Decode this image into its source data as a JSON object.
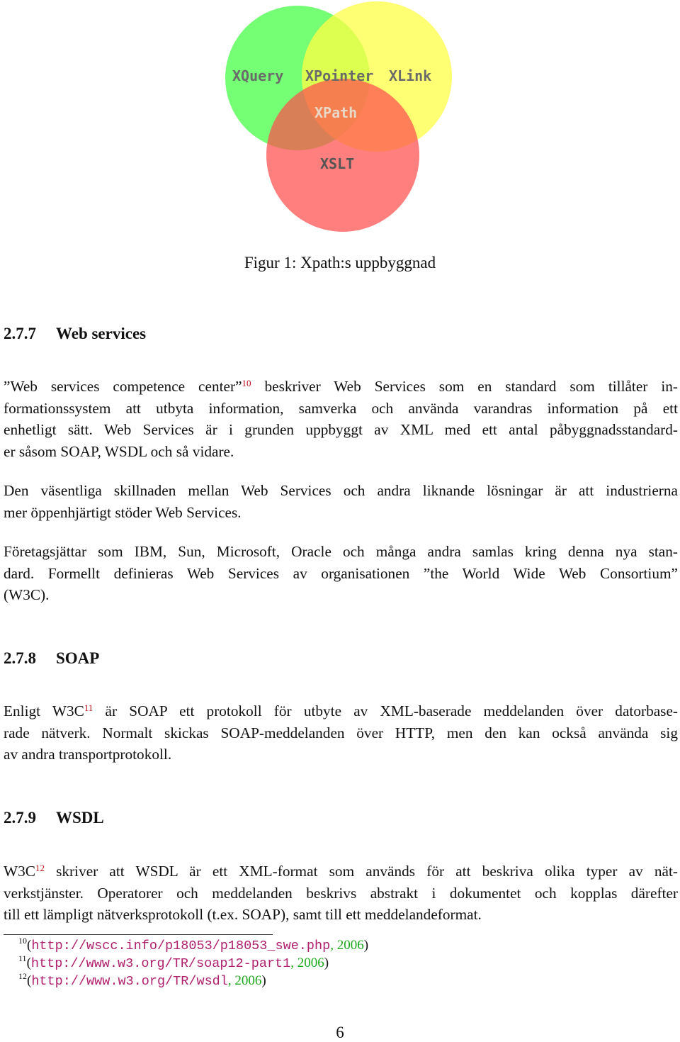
{
  "figure": {
    "circles": [
      {
        "name": "XQuery",
        "color": "#66ff66"
      },
      {
        "name": "XLink",
        "color": "#ffff66"
      },
      {
        "name": "XSLT",
        "color": "#ff6666"
      }
    ],
    "labels": {
      "xquery": "XQuery",
      "xpointer": "XPointer",
      "xlink": "XLink",
      "xpath": "XPath",
      "xslt": "XSLT"
    },
    "caption": "Figur 1: Xpath:s uppbyggnad"
  },
  "sections": [
    {
      "number": "2.7.7",
      "title": "Web services",
      "paragraphs": [
        {
          "lines": [
            "”Web services competence center”",
            "formationssystem att utbyta information, samverka och använda varandras information på ett",
            "enhetligt sätt. Web Services är i grunden uppbyggt av XML med ett antal påbyggnadsstandard-",
            "er såsom SOAP, WSDL och så vidare."
          ],
          "first_line_after_ref": " beskriver Web Services som en standard som tillåter in-",
          "footnote_ref": "10"
        },
        {
          "lines": [
            "Den väsentliga skillnaden mellan Web Services och andra liknande lösningar är att industrierna",
            "mer öppenhjärtigt stöder Web Services."
          ]
        },
        {
          "lines": [
            "Företagsjättar som IBM, Sun, Microsoft, Oracle och många andra samlas kring denna nya stan-",
            "dard. Formellt definieras Web Services av organisationen ”the World Wide Web Consortium”",
            "(W3C)."
          ]
        }
      ]
    },
    {
      "number": "2.7.8",
      "title": "SOAP",
      "paragraphs": [
        {
          "lines": [
            "Enligt W3C",
            "rade nätverk. Normalt skickas SOAP-meddelanden över HTTP, men den kan också använda sig",
            "av andra transportprotokoll."
          ],
          "first_line_after_ref": " är SOAP ett protokoll för utbyte av XML-baserade meddelanden över datorbase-",
          "footnote_ref": "11"
        }
      ]
    },
    {
      "number": "2.7.9",
      "title": "WSDL",
      "paragraphs": [
        {
          "lines": [
            "W3C",
            "verkstjänster. Operatorer och meddelanden beskrivs abstrakt i dokumentet och kopplas därefter",
            "till ett lämpligt nätverksprotokoll (t.ex. SOAP), samt till ett meddelandeformat."
          ],
          "first_line_after_ref": " skriver att WSDL är ett XML-format som används för att beskriva olika typer av nät-",
          "footnote_ref": "12"
        }
      ]
    }
  ],
  "footnotes": [
    {
      "number": "10",
      "url": "http://wscc.info/p18053/p18053_swe.php",
      "year": "2006"
    },
    {
      "number": "11",
      "url": "http://www.w3.org/TR/soap12-part1",
      "year": "2006"
    },
    {
      "number": "12",
      "url": "http://www.w3.org/TR/wsdl",
      "year": "2006"
    }
  ],
  "page_number": "6"
}
